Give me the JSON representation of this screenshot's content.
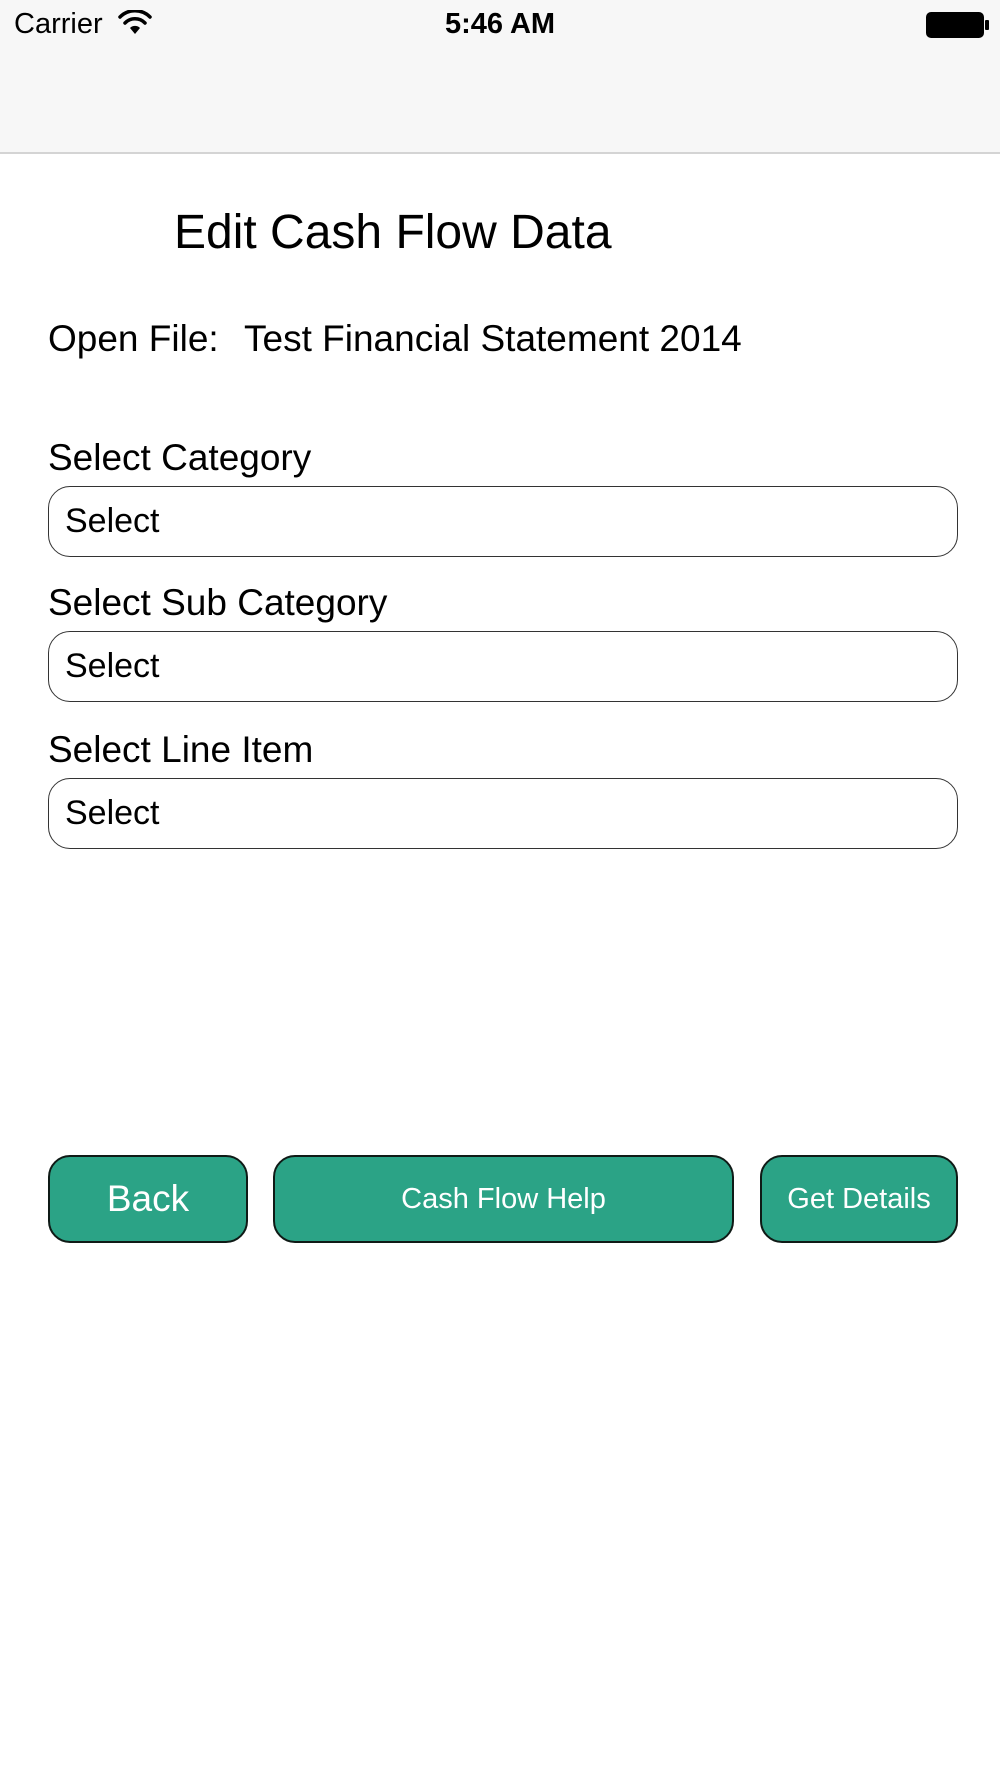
{
  "status_bar": {
    "carrier": "Carrier",
    "time": "5:46 AM",
    "wifi_icon": "wifi-icon",
    "battery_icon": "battery-icon"
  },
  "page": {
    "title": "Edit Cash Flow Data",
    "open_file_label": "Open File:",
    "open_file_name": "Test Financial Statement 2014"
  },
  "fields": {
    "category": {
      "label": "Select Category",
      "value": "Select"
    },
    "sub_category": {
      "label": "Select Sub Category",
      "value": "Select"
    },
    "line_item": {
      "label": "Select Line Item",
      "value": "Select"
    }
  },
  "buttons": {
    "back": "Back",
    "help": "Cash Flow Help",
    "details": "Get Details"
  },
  "colors": {
    "button_bg": "#2ba386",
    "button_text": "#ffffff",
    "status_bar_bg": "#f7f7f7"
  }
}
